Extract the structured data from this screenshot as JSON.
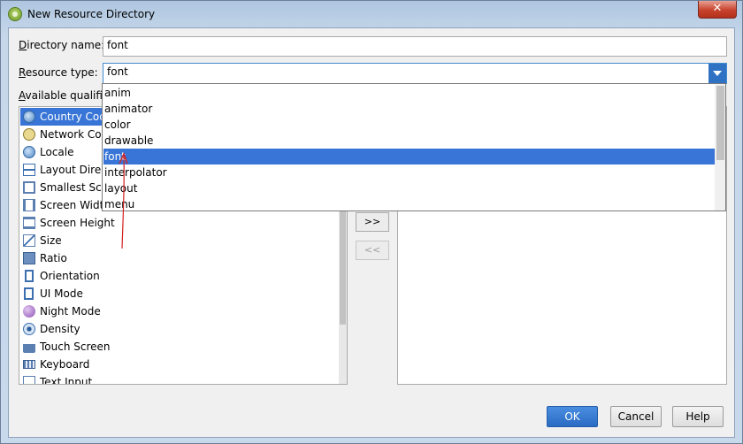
{
  "window": {
    "title": "New Resource Directory",
    "close_glyph": "✕"
  },
  "form": {
    "directory_label_mn": "D",
    "directory_label": "irectory name:",
    "directory_value": "font",
    "resource_label_mn": "R",
    "resource_label": "esource type:",
    "resource_value": "font",
    "qualifiers_label_pre": "A",
    "qualifiers_label": "vailable qualifier"
  },
  "qualifiers": [
    {
      "label": "Country Code",
      "icon": "globe-icon",
      "selected": true
    },
    {
      "label": "Network Code",
      "icon": "network-icon"
    },
    {
      "label": "Locale",
      "icon": "globe-icon"
    },
    {
      "label": "Layout Directi",
      "icon": "layout-direction-icon"
    },
    {
      "label": "Smallest Scree",
      "icon": "smallest-screen-icon"
    },
    {
      "label": "Screen Width",
      "icon": "screen-width-icon"
    },
    {
      "label": "Screen Height",
      "icon": "screen-height-icon"
    },
    {
      "label": "Size",
      "icon": "size-icon"
    },
    {
      "label": "Ratio",
      "icon": "ratio-icon"
    },
    {
      "label": "Orientation",
      "icon": "orientation-icon"
    },
    {
      "label": "UI Mode",
      "icon": "ui-mode-icon"
    },
    {
      "label": "Night Mode",
      "icon": "night-mode-icon"
    },
    {
      "label": "Density",
      "icon": "density-icon"
    },
    {
      "label": "Touch Screen",
      "icon": "touch-screen-icon"
    },
    {
      "label": "Keyboard",
      "icon": "keyboard-icon"
    },
    {
      "label": "Text Input",
      "icon": "text-input-icon"
    }
  ],
  "movers": {
    "add": ">>",
    "remove": "<<"
  },
  "dropdown_options": [
    {
      "label": "anim"
    },
    {
      "label": "animator"
    },
    {
      "label": "color"
    },
    {
      "label": "drawable"
    },
    {
      "label": "font",
      "selected": true
    },
    {
      "label": "interpolator"
    },
    {
      "label": "layout"
    },
    {
      "label": "menu"
    }
  ],
  "buttons": {
    "ok": "OK",
    "cancel": "Cancel",
    "help": "Help"
  },
  "colors": {
    "selection": "#3875d7",
    "combo_button": "#2f72c4",
    "annotation_arrow": "#d42020"
  }
}
